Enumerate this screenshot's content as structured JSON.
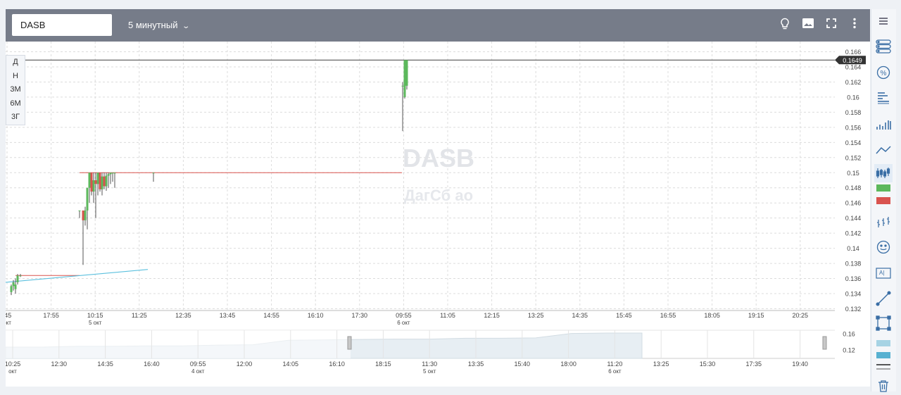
{
  "toolbar": {
    "ticker": "DASB",
    "interval": "5 минутный"
  },
  "period_buttons": [
    "Д",
    "Н",
    "3М",
    "6М",
    "3Г"
  ],
  "watermark": {
    "symbol": "DASB",
    "name": "ДагСб ао"
  },
  "colors": {
    "up": "#5cb85c",
    "down": "#d9534f",
    "trendline": "#5bc0de",
    "navigator_fill": "#e7eef3"
  },
  "chart_data": {
    "type": "candlestick",
    "ylim": [
      0.132,
      0.166
    ],
    "y_ticks": [
      "0.166",
      "0.164",
      "0.162",
      "0.16",
      "0.158",
      "0.156",
      "0.154",
      "0.152",
      "0.15",
      "0.148",
      "0.146",
      "0.144",
      "0.142",
      "0.14",
      "0.138",
      "0.136",
      "0.134",
      "0.132"
    ],
    "last_price": "0.1649",
    "x_ticks": [
      {
        "label": ":45",
        "sub": "окт"
      },
      {
        "label": "17:55",
        "sub": ""
      },
      {
        "label": "10:15",
        "sub": "5  окт"
      },
      {
        "label": "11:25",
        "sub": ""
      },
      {
        "label": "12:35",
        "sub": ""
      },
      {
        "label": "13:45",
        "sub": ""
      },
      {
        "label": "14:55",
        "sub": ""
      },
      {
        "label": "16:10",
        "sub": ""
      },
      {
        "label": "17:30",
        "sub": ""
      },
      {
        "label": "09:55",
        "sub": "6  окт"
      },
      {
        "label": "11:05",
        "sub": ""
      },
      {
        "label": "12:15",
        "sub": ""
      },
      {
        "label": "13:25",
        "sub": ""
      },
      {
        "label": "14:35",
        "sub": ""
      },
      {
        "label": "15:45",
        "sub": ""
      },
      {
        "label": "16:55",
        "sub": ""
      },
      {
        "label": "18:05",
        "sub": ""
      },
      {
        "label": "19:15",
        "sub": ""
      },
      {
        "label": "20:25",
        "sub": ""
      }
    ],
    "candles": [
      {
        "o": 0.1342,
        "h": 0.1352,
        "l": 0.1338,
        "c": 0.135
      },
      {
        "o": 0.135,
        "h": 0.1358,
        "l": 0.1344,
        "c": 0.1355
      },
      {
        "o": 0.1346,
        "h": 0.136,
        "l": 0.134,
        "c": 0.1352
      },
      {
        "o": 0.1355,
        "h": 0.1366,
        "l": 0.1352,
        "c": 0.1364
      },
      {
        "o": 0.1364,
        "h": 0.1366,
        "l": 0.1362,
        "c": 0.1364
      },
      {
        "o": 0.145,
        "h": 0.145,
        "l": 0.144,
        "c": 0.145
      },
      {
        "o": 0.145,
        "h": 0.145,
        "l": 0.1378,
        "c": 0.1437
      },
      {
        "o": 0.1437,
        "h": 0.1455,
        "l": 0.143,
        "c": 0.145
      },
      {
        "o": 0.145,
        "h": 0.147,
        "l": 0.1425,
        "c": 0.148
      },
      {
        "o": 0.148,
        "h": 0.15,
        "l": 0.146,
        "c": 0.15
      },
      {
        "o": 0.15,
        "h": 0.15,
        "l": 0.147,
        "c": 0.1475
      },
      {
        "o": 0.1475,
        "h": 0.15,
        "l": 0.146,
        "c": 0.149
      },
      {
        "o": 0.149,
        "h": 0.15,
        "l": 0.144,
        "c": 0.1485
      },
      {
        "o": 0.1485,
        "h": 0.15,
        "l": 0.147,
        "c": 0.15
      },
      {
        "o": 0.15,
        "h": 0.15,
        "l": 0.1475,
        "c": 0.1478
      },
      {
        "o": 0.1478,
        "h": 0.15,
        "l": 0.147,
        "c": 0.1495
      },
      {
        "o": 0.1495,
        "h": 0.15,
        "l": 0.1478,
        "c": 0.1482
      },
      {
        "o": 0.1482,
        "h": 0.15,
        "l": 0.1476,
        "c": 0.1496
      },
      {
        "o": 0.1496,
        "h": 0.15,
        "l": 0.148,
        "c": 0.1498
      },
      {
        "o": 0.1498,
        "h": 0.15,
        "l": 0.1485,
        "c": 0.15
      },
      {
        "o": 0.15,
        "h": 0.15,
        "l": 0.1488,
        "c": 0.15
      },
      {
        "o": 0.15,
        "h": 0.15,
        "l": 0.148,
        "c": 0.15
      },
      {
        "o": 0.15,
        "h": 0.15,
        "l": 0.1488,
        "c": 0.15
      },
      {
        "o": 0.1615,
        "h": 0.162,
        "l": 0.1555,
        "c": 0.1615
      },
      {
        "o": 0.16,
        "h": 0.1649,
        "l": 0.1598,
        "c": 0.1649
      },
      {
        "o": 0.1615,
        "h": 0.1649,
        "l": 0.161,
        "c": 0.1649
      }
    ],
    "navigator": {
      "y_ticks": [
        "0.16",
        "0.12"
      ],
      "x_ticks": [
        {
          "label": "10:25",
          "sub": "  окт"
        },
        {
          "label": "12:30",
          "sub": ""
        },
        {
          "label": "14:35",
          "sub": ""
        },
        {
          "label": "16:40",
          "sub": ""
        },
        {
          "label": "09:55",
          "sub": "4  окт"
        },
        {
          "label": "12:00",
          "sub": ""
        },
        {
          "label": "14:05",
          "sub": ""
        },
        {
          "label": "16:10",
          "sub": ""
        },
        {
          "label": "18:15",
          "sub": ""
        },
        {
          "label": "11:30",
          "sub": "5  окт"
        },
        {
          "label": "13:35",
          "sub": ""
        },
        {
          "label": "15:40",
          "sub": ""
        },
        {
          "label": "18:00",
          "sub": ""
        },
        {
          "label": "11:20",
          "sub": "6  окт"
        },
        {
          "label": "13:25",
          "sub": ""
        },
        {
          "label": "15:30",
          "sub": ""
        },
        {
          "label": "17:35",
          "sub": ""
        },
        {
          "label": "19:40",
          "sub": ""
        }
      ],
      "series": [
        0.128,
        0.128,
        0.13,
        0.13,
        0.131,
        0.131,
        0.133,
        0.134,
        0.145,
        0.146,
        0.147,
        0.148,
        0.148,
        0.15,
        0.15,
        0.151,
        0.162,
        0.163,
        0.163
      ]
    }
  }
}
